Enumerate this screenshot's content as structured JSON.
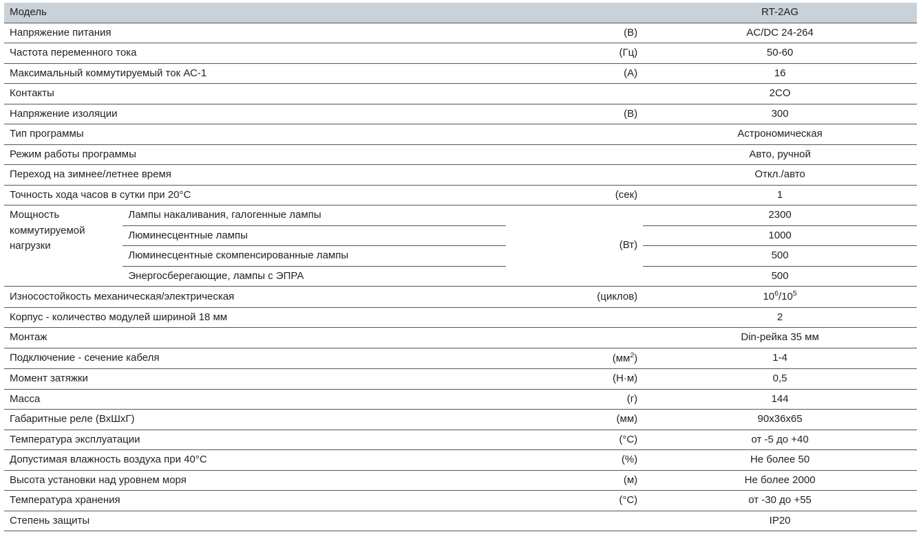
{
  "header": {
    "model_label": "Модель",
    "model_value": "RT-2AG"
  },
  "rows": [
    {
      "label": "Напряжение питания",
      "unit": "(В)",
      "value": "AC/DC 24-264"
    },
    {
      "label": "Частота переменного тока",
      "unit": "(Гц)",
      "value": "50-60"
    },
    {
      "label": "Максимальный коммутируемый ток АС-1",
      "unit": "(А)",
      "value": "16"
    },
    {
      "label": "Контакты",
      "unit": "",
      "value": "2CO"
    },
    {
      "label": "Напряжение изоляции",
      "unit": "(В)",
      "value": "300"
    },
    {
      "label": "Тип программы",
      "unit": "",
      "value": "Астрономическая"
    },
    {
      "label": "Режим работы программы",
      "unit": "",
      "value": "Авто, ручной"
    },
    {
      "label": "Переход на зимнее/летнее время",
      "unit": "",
      "value": "Откл./авто"
    },
    {
      "label": "Точность хода часов в сутки при 20°С",
      "unit": "(сек)",
      "value": "1"
    }
  ],
  "power_section": {
    "group_label": "Мощность коммутируемой нагрузки",
    "unit": "(Вт)",
    "items": [
      {
        "label": "Лампы накаливания, галогенные лампы",
        "value": "2300"
      },
      {
        "label": "Люминесцентные лампы",
        "value": "1000"
      },
      {
        "label": "Люминесцентные скомпенсированные лампы",
        "value": "500"
      },
      {
        "label": "Энергосберегающие, лампы с ЭПРА",
        "value": "500"
      }
    ]
  },
  "durability": {
    "label": "Износостойкость механическая/электрическая",
    "unit": "(циклов)",
    "value_html": "10⁶/10⁵",
    "value_base1": "10",
    "value_exp1": "6",
    "value_base2": "10",
    "value_exp2": "5"
  },
  "rows2": [
    {
      "label": "Корпус - количество модулей шириной 18 мм",
      "unit": "",
      "value": "2"
    },
    {
      "label": "Монтаж",
      "unit": "",
      "value": "Din-рейка 35 мм"
    }
  ],
  "cable": {
    "label": "Подключение - сечение кабеля",
    "unit_pre": "(мм",
    "unit_exp": "2",
    "unit_post": ")",
    "value": "1-4"
  },
  "rows3": [
    {
      "label": "Момент затяжки",
      "unit": "(Н·м)",
      "value": "0,5"
    },
    {
      "label": "Масса",
      "unit": "(г)",
      "value": "144"
    },
    {
      "label": "Габаритные реле (ВхШхГ)",
      "unit": "(мм)",
      "value": "90x36x65"
    },
    {
      "label": "Температура эксплуатации",
      "unit": "(°С)",
      "value": "от -5 до +40"
    },
    {
      "label": "Допустимая влажность воздуха при 40°С",
      "unit": "(%)",
      "value": "Не более 50"
    },
    {
      "label": "Высота установки над уровнем моря",
      "unit": "(м)",
      "value": "Не более 2000"
    },
    {
      "label": "Температура хранения",
      "unit": "(°С)",
      "value": "от -30 до +55"
    },
    {
      "label": "Степень защиты",
      "unit": "",
      "value": "IP20"
    }
  ]
}
